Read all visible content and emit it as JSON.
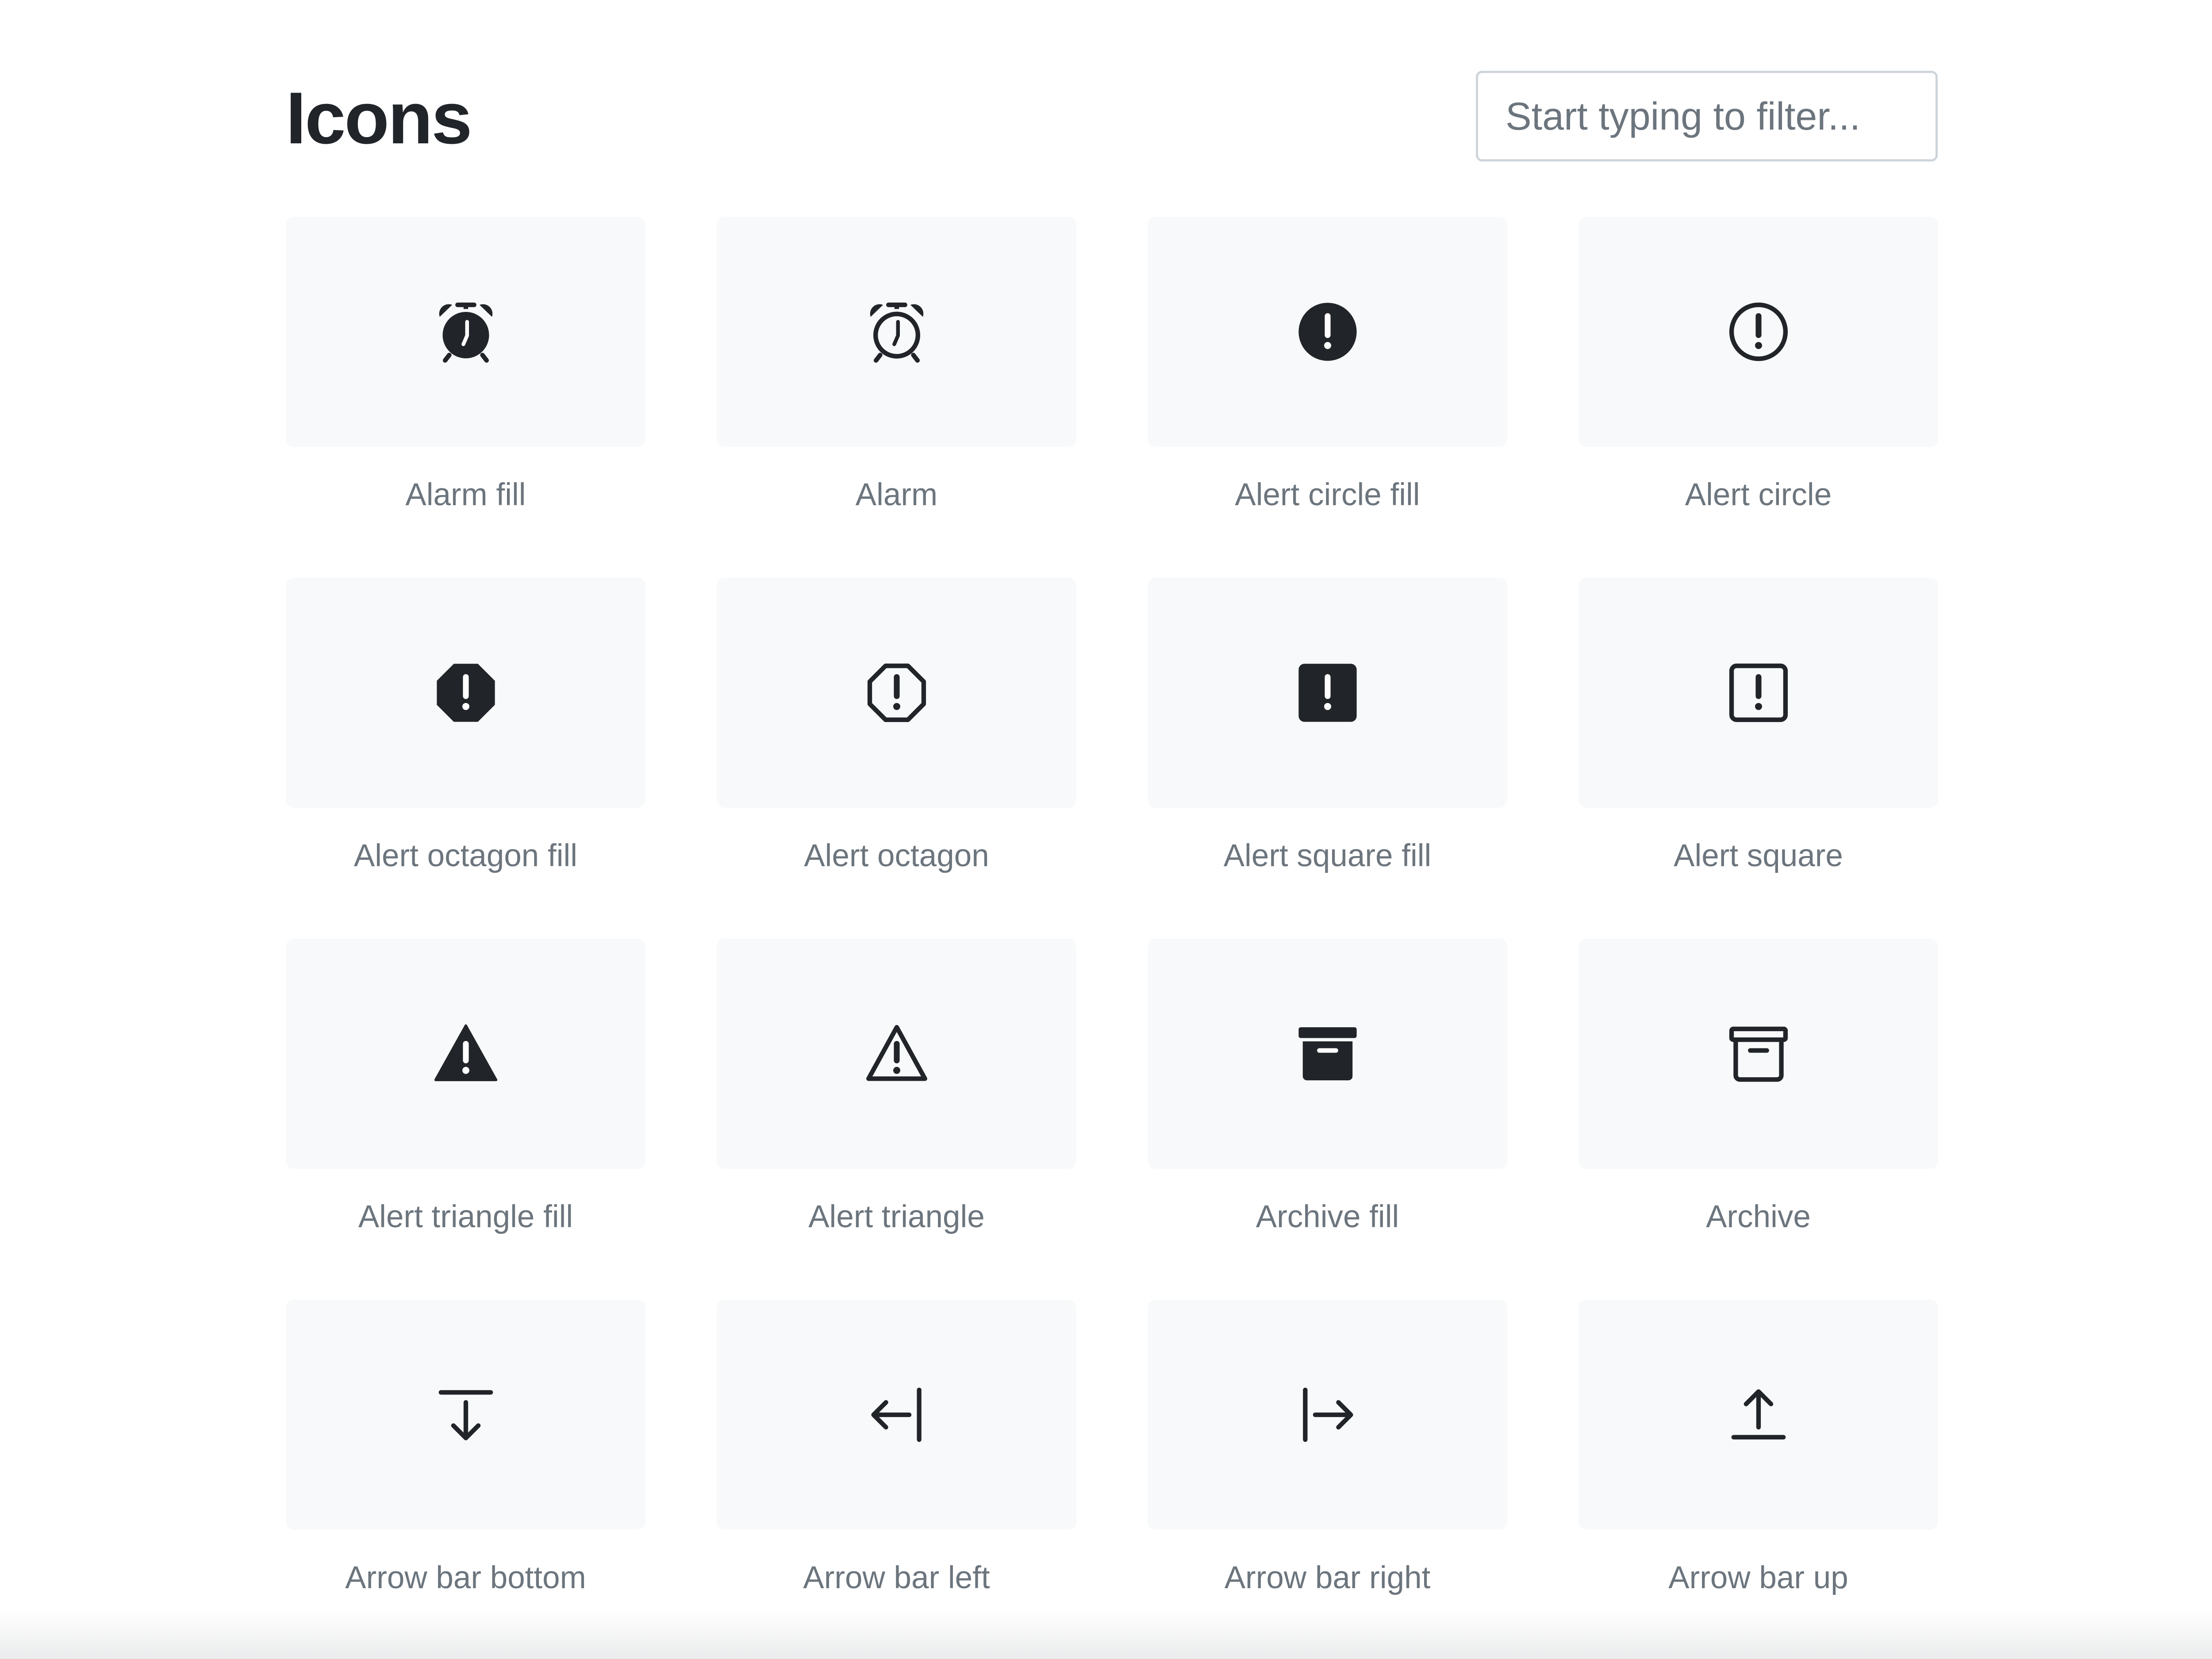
{
  "header": {
    "title": "Icons",
    "filter_placeholder": "Start typing to filter..."
  },
  "colors": {
    "tile_background": "#f8f9fa",
    "icon_color": "#212529",
    "label_color": "#6c757d",
    "input_border": "#ced4da"
  },
  "icons": [
    {
      "label": "Alarm fill",
      "icon": "alarm-fill"
    },
    {
      "label": "Alarm",
      "icon": "alarm"
    },
    {
      "label": "Alert circle fill",
      "icon": "alert-circle-fill"
    },
    {
      "label": "Alert circle",
      "icon": "alert-circle"
    },
    {
      "label": "Alert octagon fill",
      "icon": "alert-octagon-fill"
    },
    {
      "label": "Alert octagon",
      "icon": "alert-octagon"
    },
    {
      "label": "Alert square fill",
      "icon": "alert-square-fill"
    },
    {
      "label": "Alert square",
      "icon": "alert-square"
    },
    {
      "label": "Alert triangle fill",
      "icon": "alert-triangle-fill"
    },
    {
      "label": "Alert triangle",
      "icon": "alert-triangle"
    },
    {
      "label": "Archive fill",
      "icon": "archive-fill"
    },
    {
      "label": "Archive",
      "icon": "archive"
    },
    {
      "label": "Arrow bar bottom",
      "icon": "arrow-bar-bottom"
    },
    {
      "label": "Arrow bar left",
      "icon": "arrow-bar-left"
    },
    {
      "label": "Arrow bar right",
      "icon": "arrow-bar-right"
    },
    {
      "label": "Arrow bar up",
      "icon": "arrow-bar-up"
    }
  ]
}
